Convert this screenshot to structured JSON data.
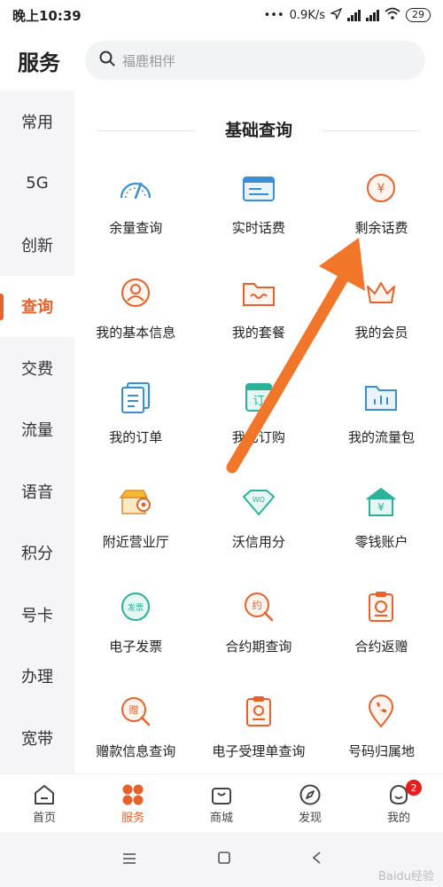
{
  "status": {
    "time": "晚上10:39",
    "speed": "0.9K/s",
    "battery": "29"
  },
  "header": {
    "title": "服务",
    "search_placeholder": "福鹿相伴"
  },
  "sidebar": {
    "items": [
      {
        "label": "常用"
      },
      {
        "label": "5G"
      },
      {
        "label": "创新"
      },
      {
        "label": "查询"
      },
      {
        "label": "交费"
      },
      {
        "label": "流量"
      },
      {
        "label": "语音"
      },
      {
        "label": "积分"
      },
      {
        "label": "号卡"
      },
      {
        "label": "办理"
      },
      {
        "label": "宽带"
      }
    ],
    "active": "查询"
  },
  "main": {
    "section_title": "基础查询",
    "items": [
      {
        "label": "余量查询",
        "icon": "gauge-icon"
      },
      {
        "label": "实时话费",
        "icon": "bill-icon"
      },
      {
        "label": "剩余话费",
        "icon": "yen-coin-icon"
      },
      {
        "label": "我的基本信息",
        "icon": "profile-icon"
      },
      {
        "label": "我的套餐",
        "icon": "package-icon"
      },
      {
        "label": "我的会员",
        "icon": "crown-icon"
      },
      {
        "label": "我的订单",
        "icon": "order-icon"
      },
      {
        "label": "我已订购",
        "icon": "subscription-icon"
      },
      {
        "label": "我的流量包",
        "icon": "folder-chart-icon"
      },
      {
        "label": "附近营业厅",
        "icon": "store-location-icon"
      },
      {
        "label": "沃信用分",
        "icon": "diamond-icon"
      },
      {
        "label": "零钱账户",
        "icon": "wallet-house-icon"
      },
      {
        "label": "电子发票",
        "icon": "invoice-icon"
      },
      {
        "label": "合约期查询",
        "icon": "contract-search-icon"
      },
      {
        "label": "合约返赠",
        "icon": "clipboard-coin-icon"
      },
      {
        "label": "赠款信息查询",
        "icon": "gift-search-icon"
      },
      {
        "label": "电子受理单查询",
        "icon": "receipt-icon"
      },
      {
        "label": "号码归属地",
        "icon": "phone-pin-icon"
      }
    ]
  },
  "bottom_nav": [
    {
      "label": "首页",
      "icon": "home-icon"
    },
    {
      "label": "服务",
      "icon": "services-icon"
    },
    {
      "label": "商城",
      "icon": "bag-icon"
    },
    {
      "label": "发现",
      "icon": "compass-icon"
    },
    {
      "label": "我的",
      "icon": "user-icon",
      "badge": "2"
    }
  ],
  "colors": {
    "accent": "#e8612a",
    "blue": "#3a8fd4",
    "green": "#2bb39a",
    "badge": "#e61e1e"
  },
  "watermark": "Baidu经验"
}
